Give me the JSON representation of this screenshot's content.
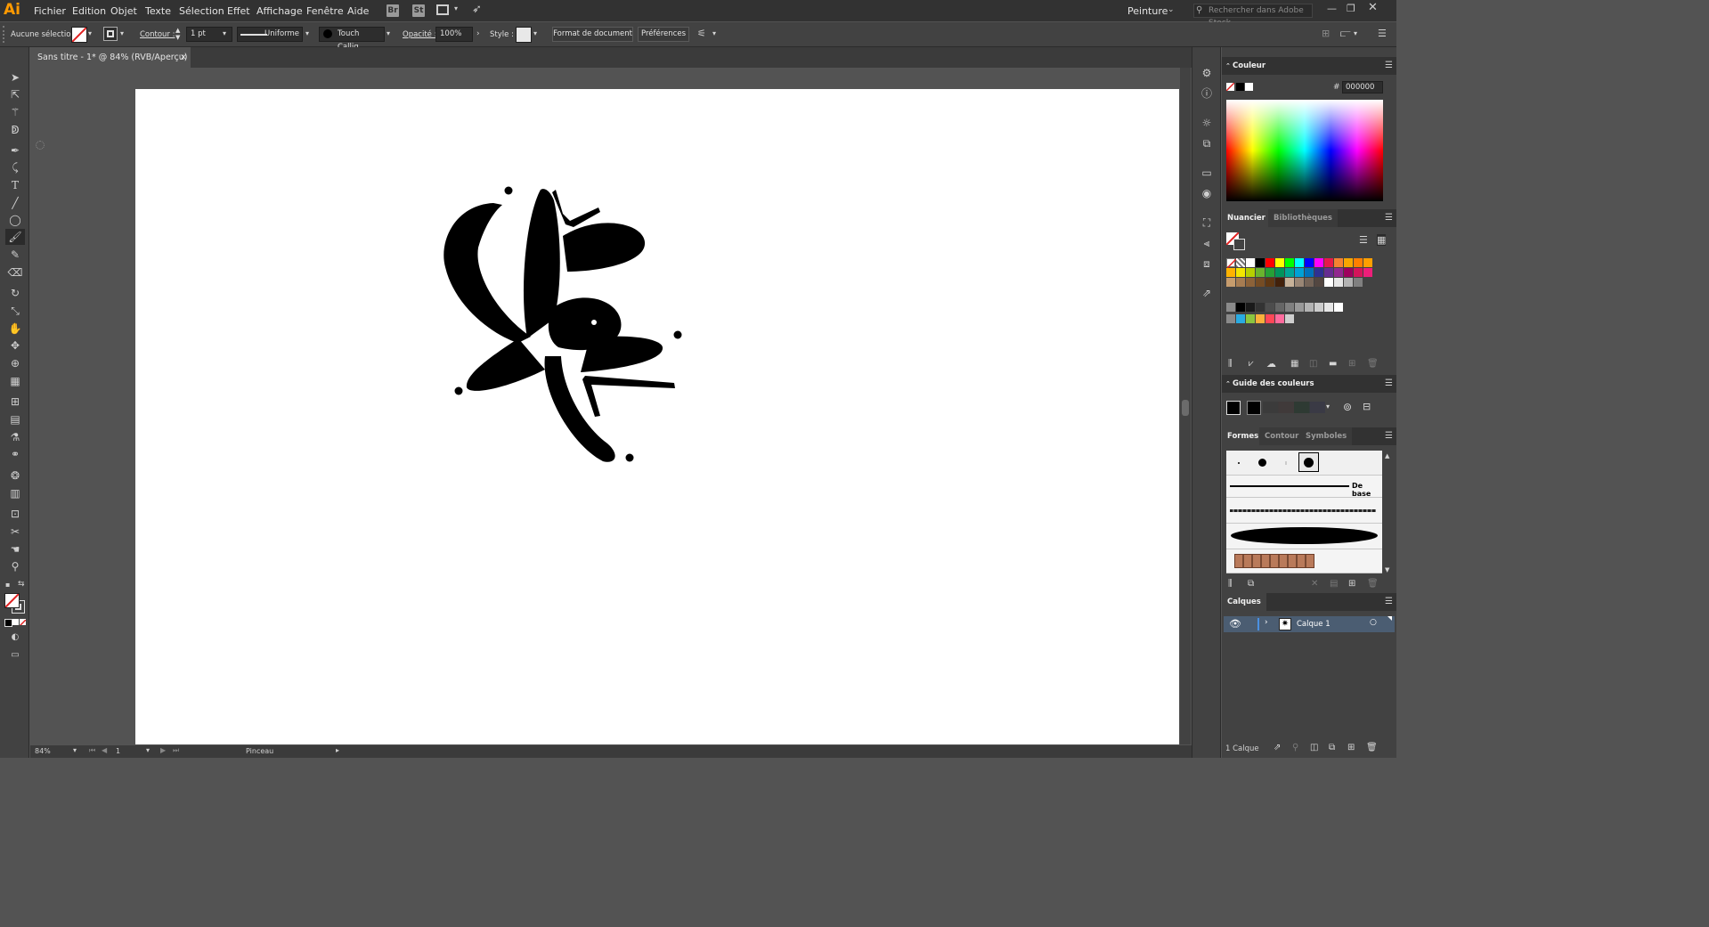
{
  "app": {
    "logo": "Ai",
    "brand_color": "#ff9a00"
  },
  "menu": [
    "Fichier",
    "Edition",
    "Objet",
    "Texte",
    "Sélection",
    "Effet",
    "Affichage",
    "Fenêtre",
    "Aide"
  ],
  "menu_buttons": {
    "bridge": "Br",
    "stock": "St"
  },
  "workspace": "Peinture",
  "search": {
    "placeholder": "Rechercher dans Adobe Stock"
  },
  "control_bar": {
    "selection_label": "Aucune sélection",
    "stroke_label": "Contour :",
    "stroke_weight": "1 pt",
    "profile": "Uniforme",
    "brush": "Touch Callig...",
    "opacity_label": "Opacité :",
    "opacity": "100%",
    "style_label": "Style :",
    "doc_format_btn": "Format de document",
    "prefs_btn": "Préférences"
  },
  "document_tab": {
    "title": "Sans titre - 1* @ 84% (RVB/Aperçu)",
    "close": "×"
  },
  "status": {
    "zoom": "84%",
    "page": "1",
    "tool": "Pinceau"
  },
  "panels": {
    "color": {
      "title": "Couleur",
      "hex_label": "#",
      "hex": "000000"
    },
    "swatches": {
      "tab_active": "Nuancier",
      "tab_other": "Bibliothèques"
    },
    "color_guide": {
      "title": "Guide des couleurs"
    },
    "brushes": {
      "tab_active": "Formes",
      "tab_contour": "Contour",
      "tab_symbols": "Symboles",
      "basic_label": "De base"
    },
    "layers": {
      "title": "Calques",
      "layer_name": "Calque 1",
      "count": "1 Calque"
    }
  },
  "swatch_colors": [
    "#ffffff",
    "#000000",
    "#ff0000",
    "#ffff00",
    "#00ff00",
    "#00ffff",
    "#0000ff",
    "#ff00ff",
    "#e6194b",
    "#f58231",
    "#f7a600",
    "#ff7f00",
    "#ff9f00",
    "#ffb300",
    "#f3e600",
    "#b6d000",
    "#6ab42d",
    "#26a036",
    "#00945c",
    "#00a597",
    "#00a1d6",
    "#0072bc",
    "#2e3192",
    "#662d91",
    "#92278f",
    "#9e005d",
    "#d4145a",
    "#ed1e79",
    "#c69c6d",
    "#a67c52",
    "#8c6239",
    "#754c24",
    "#603813",
    "#42210b",
    "#c7b299",
    "#998675",
    "#736357",
    "#534741",
    "#ffffff",
    "#e6e6e6",
    "#b3b3b3",
    "#808080"
  ],
  "gray_colors": [
    "#000000",
    "#1a1a1a",
    "#333333",
    "#4d4d4d",
    "#666666",
    "#808080",
    "#999999",
    "#b3b3b3",
    "#cccccc",
    "#e6e6e6",
    "#ffffff"
  ],
  "extra_colors": [
    "#29abe2",
    "#8cc63f",
    "#fbb03b",
    "#ff4757",
    "#ff6b9d",
    "#cfcfcf"
  ]
}
